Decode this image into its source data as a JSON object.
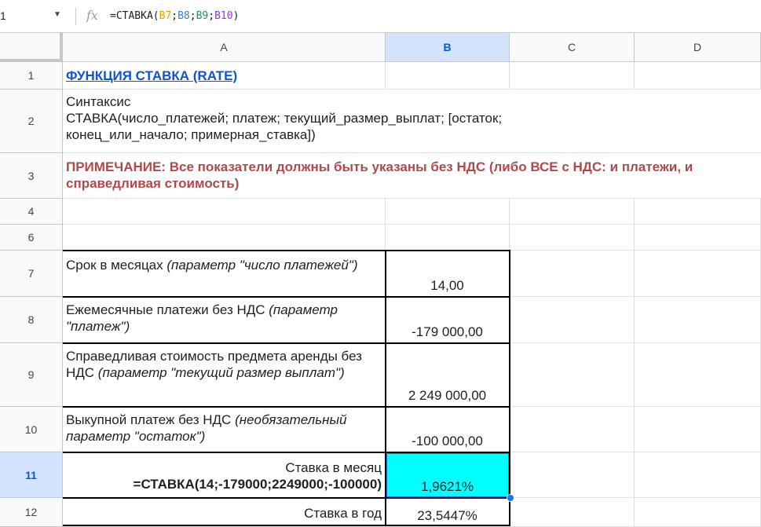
{
  "formula_bar": {
    "cell_ref": "1",
    "fx_icon": "fx",
    "formula_prefix": "=СТАВКА(",
    "formula_refs": [
      "B7",
      "B8",
      "B9",
      "B10"
    ],
    "formula_sep": ";",
    "formula_suffix": ")"
  },
  "columns": [
    "A",
    "B",
    "C",
    "D"
  ],
  "selected_column": "B",
  "rows": [
    "1",
    "2",
    "3",
    "4",
    "6",
    "7",
    "8",
    "9",
    "10",
    "11",
    "12"
  ],
  "selected_row": "11",
  "cells": {
    "a1": "ФУНКЦИЯ СТАВКА (RATE)",
    "a2_line1": "Синтаксис",
    "a2_line2": "СТАВКА(число_платежей; платеж; текущий_размер_выплат; [остаток;",
    "a2_line3": "конец_или_начало; примерная_ставка])",
    "a3_label": "ПРИМЕЧАНИЕ:",
    "a3_text": " Все показатели должны быть указаны без НДС (либо ВСЕ с НДС: и платежи, и справедливая стоимость)",
    "a7_text": "Срок в месяцах ",
    "a7_italic": "(параметр \"число платежей\")",
    "b7": "14,00",
    "a8_text": "Ежемесячные платежи без НДС ",
    "a8_italic": "(параметр \"платеж\")",
    "b8": "-179 000,00",
    "a9_text": "Справедливая стоимость предмета аренды без НДС ",
    "a9_italic": "(параметр \"текущий размер выплат\")",
    "b9": "2 249 000,00",
    "a10_text": "Выкупной платеж без НДС ",
    "a10_italic": "(необязательный параметр \"остаток\")",
    "b10": "-100 000,00",
    "a11_line1": "Ставка в месяц",
    "a11_line2": "=СТАВКА(14;-179000;2249000;-100000)",
    "b11": "1,9621%",
    "a12": "Ставка в год",
    "b12": "23,5447%"
  },
  "colors": {
    "selected_fill": "#00ffff",
    "title": "#1155cc",
    "note": "#b04a4a",
    "selection_accent": "#1a73e8"
  }
}
